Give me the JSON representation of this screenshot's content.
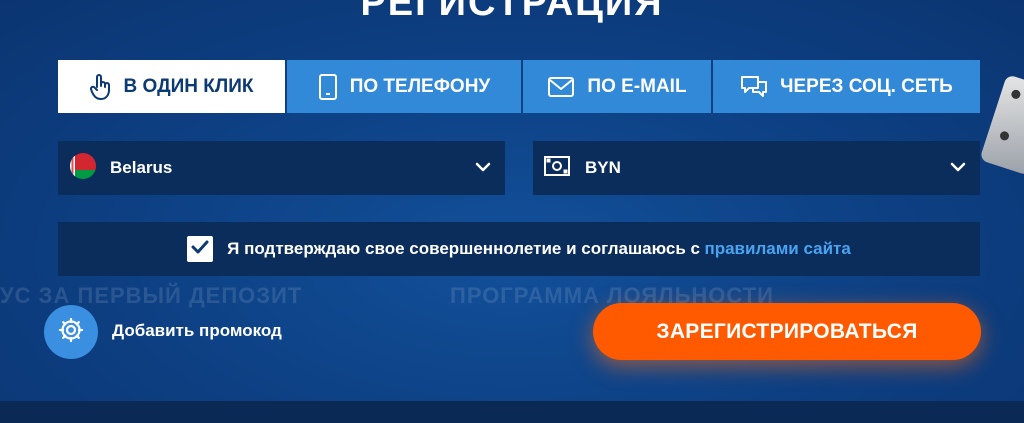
{
  "page": {
    "title": "РЕГИСТРАЦИЯ"
  },
  "background": {
    "left_text": "УС ЗА ПЕРВЫЙ ДЕПОЗИТ",
    "right_text": "ПРОГРАММА ЛОЯЛЬНОСТИ"
  },
  "tabs": [
    {
      "label": "В ОДИН КЛИК",
      "icon": "hand-pointer-icon",
      "active": true
    },
    {
      "label": "ПО ТЕЛЕФОНУ",
      "icon": "phone-icon",
      "active": false
    },
    {
      "label": "ПО E-MAIL",
      "icon": "envelope-icon",
      "active": false
    },
    {
      "label": "ЧЕРЕЗ СОЦ. СЕТЬ",
      "icon": "chat-icon",
      "active": false
    }
  ],
  "country_select": {
    "value": "Belarus",
    "icon": "belarus-flag-icon"
  },
  "currency_select": {
    "value": "BYN",
    "icon": "banknote-icon"
  },
  "agreement": {
    "checked": true,
    "text": "Я подтверждаю свое совершеннолетие и соглашаюсь с",
    "link_text": "правилами сайта"
  },
  "promo": {
    "label": "Добавить промокод",
    "icon": "gear-icon"
  },
  "register": {
    "label": "ЗАРЕГИСТРИРОВАТЬСЯ"
  },
  "colors": {
    "tab_bg": "#3189d8",
    "active_tab_bg": "#ffffff",
    "field_bg": "#0a2d5c",
    "link": "#4aa3f0",
    "register_bg": "#ff5a00",
    "background": "#0d3f82"
  }
}
